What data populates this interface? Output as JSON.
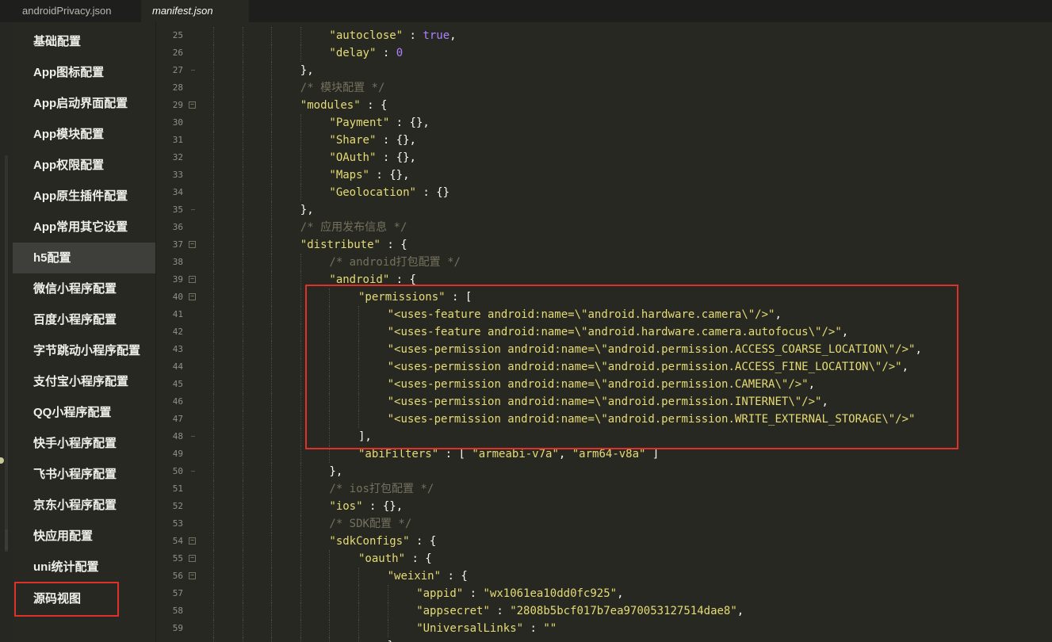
{
  "tabs": [
    {
      "label": "androidPrivacy.json",
      "active": false
    },
    {
      "label": "manifest.json",
      "active": true
    }
  ],
  "sidebar": {
    "items": [
      {
        "label": "基础配置"
      },
      {
        "label": "App图标配置"
      },
      {
        "label": "App启动界面配置"
      },
      {
        "label": "App模块配置"
      },
      {
        "label": "App权限配置"
      },
      {
        "label": "App原生插件配置"
      },
      {
        "label": "App常用其它设置"
      },
      {
        "label": "h5配置",
        "active": true
      },
      {
        "label": "微信小程序配置"
      },
      {
        "label": "百度小程序配置"
      },
      {
        "label": "字节跳动小程序配置"
      },
      {
        "label": "支付宝小程序配置"
      },
      {
        "label": "QQ小程序配置"
      },
      {
        "label": "快手小程序配置"
      },
      {
        "label": "飞书小程序配置"
      },
      {
        "label": "京东小程序配置"
      },
      {
        "label": "快应用配置"
      },
      {
        "label": "uni统计配置"
      },
      {
        "label": "源码视图",
        "highlighted": true
      }
    ]
  },
  "editor": {
    "lines": [
      {
        "n": "25",
        "indent": 4,
        "fold": "",
        "tokens": [
          [
            "k",
            "\"autoclose\""
          ],
          [
            "p",
            " : "
          ],
          [
            "b",
            "true"
          ],
          [
            "p",
            ","
          ]
        ]
      },
      {
        "n": "26",
        "indent": 4,
        "fold": "",
        "tokens": [
          [
            "k",
            "\"delay\""
          ],
          [
            "p",
            " : "
          ],
          [
            "b",
            "0"
          ]
        ]
      },
      {
        "n": "27",
        "indent": 3,
        "fold": "end",
        "tokens": [
          [
            "p",
            "},"
          ]
        ]
      },
      {
        "n": "28",
        "indent": 3,
        "fold": "",
        "tokens": [
          [
            "c",
            "/* 模块配置 */"
          ]
        ]
      },
      {
        "n": "29",
        "indent": 3,
        "fold": "open",
        "tokens": [
          [
            "k",
            "\"modules\""
          ],
          [
            "p",
            " : {"
          ]
        ]
      },
      {
        "n": "30",
        "indent": 4,
        "fold": "",
        "tokens": [
          [
            "k",
            "\"Payment\""
          ],
          [
            "p",
            " : {},"
          ]
        ]
      },
      {
        "n": "31",
        "indent": 4,
        "fold": "",
        "tokens": [
          [
            "k",
            "\"Share\""
          ],
          [
            "p",
            " : {},"
          ]
        ]
      },
      {
        "n": "32",
        "indent": 4,
        "fold": "",
        "tokens": [
          [
            "k",
            "\"OAuth\""
          ],
          [
            "p",
            " : {},"
          ]
        ]
      },
      {
        "n": "33",
        "indent": 4,
        "fold": "",
        "tokens": [
          [
            "k",
            "\"Maps\""
          ],
          [
            "p",
            " : {},"
          ]
        ]
      },
      {
        "n": "34",
        "indent": 4,
        "fold": "",
        "tokens": [
          [
            "k",
            "\"Geolocation\""
          ],
          [
            "p",
            " : {}"
          ]
        ]
      },
      {
        "n": "35",
        "indent": 3,
        "fold": "end",
        "tokens": [
          [
            "p",
            "},"
          ]
        ]
      },
      {
        "n": "36",
        "indent": 3,
        "fold": "",
        "tokens": [
          [
            "c",
            "/* 应用发布信息 */"
          ]
        ]
      },
      {
        "n": "37",
        "indent": 3,
        "fold": "open",
        "tokens": [
          [
            "k",
            "\"distribute\""
          ],
          [
            "p",
            " : {"
          ]
        ]
      },
      {
        "n": "38",
        "indent": 4,
        "fold": "",
        "tokens": [
          [
            "c",
            "/* android打包配置 */"
          ]
        ]
      },
      {
        "n": "39",
        "indent": 4,
        "fold": "open",
        "tokens": [
          [
            "k",
            "\"android\""
          ],
          [
            "p",
            " : {"
          ]
        ]
      },
      {
        "n": "40",
        "indent": 5,
        "fold": "open",
        "tokens": [
          [
            "k",
            "\"permissions\""
          ],
          [
            "p",
            " : ["
          ]
        ]
      },
      {
        "n": "41",
        "indent": 6,
        "fold": "",
        "tokens": [
          [
            "s",
            "\"<uses-feature android:name=\\\"android.hardware.camera\\\"/>\""
          ],
          [
            "p",
            ","
          ]
        ]
      },
      {
        "n": "42",
        "indent": 6,
        "fold": "",
        "tokens": [
          [
            "s",
            "\"<uses-feature android:name=\\\"android.hardware.camera.autofocus\\\"/>\""
          ],
          [
            "p",
            ","
          ]
        ]
      },
      {
        "n": "43",
        "indent": 6,
        "fold": "",
        "tokens": [
          [
            "s",
            "\"<uses-permission android:name=\\\"android.permission.ACCESS_COARSE_LOCATION\\\"/>\""
          ],
          [
            "p",
            ","
          ]
        ]
      },
      {
        "n": "44",
        "indent": 6,
        "fold": "",
        "tokens": [
          [
            "s",
            "\"<uses-permission android:name=\\\"android.permission.ACCESS_FINE_LOCATION\\\"/>\""
          ],
          [
            "p",
            ","
          ]
        ]
      },
      {
        "n": "45",
        "indent": 6,
        "fold": "",
        "tokens": [
          [
            "s",
            "\"<uses-permission android:name=\\\"android.permission.CAMERA\\\"/>\""
          ],
          [
            "p",
            ","
          ]
        ]
      },
      {
        "n": "46",
        "indent": 6,
        "fold": "",
        "tokens": [
          [
            "s",
            "\"<uses-permission android:name=\\\"android.permission.INTERNET\\\"/>\""
          ],
          [
            "p",
            ","
          ]
        ]
      },
      {
        "n": "47",
        "indent": 6,
        "fold": "",
        "tokens": [
          [
            "s",
            "\"<uses-permission android:name=\\\"android.permission.WRITE_EXTERNAL_STORAGE\\\"/>\""
          ]
        ]
      },
      {
        "n": "48",
        "indent": 5,
        "fold": "end",
        "tokens": [
          [
            "p",
            "],"
          ]
        ]
      },
      {
        "n": "49",
        "indent": 5,
        "fold": "",
        "tokens": [
          [
            "k",
            "\"abiFilters\""
          ],
          [
            "p",
            " : [ "
          ],
          [
            "s",
            "\"armeabi-v7a\""
          ],
          [
            "p",
            ", "
          ],
          [
            "s",
            "\"arm64-v8a\""
          ],
          [
            "p",
            " ]"
          ]
        ]
      },
      {
        "n": "50",
        "indent": 4,
        "fold": "end",
        "tokens": [
          [
            "p",
            "},"
          ]
        ]
      },
      {
        "n": "51",
        "indent": 4,
        "fold": "",
        "tokens": [
          [
            "c",
            "/* ios打包配置 */"
          ]
        ]
      },
      {
        "n": "52",
        "indent": 4,
        "fold": "",
        "tokens": [
          [
            "k",
            "\"ios\""
          ],
          [
            "p",
            " : {},"
          ]
        ]
      },
      {
        "n": "53",
        "indent": 4,
        "fold": "",
        "tokens": [
          [
            "c",
            "/* SDK配置 */"
          ]
        ]
      },
      {
        "n": "54",
        "indent": 4,
        "fold": "open",
        "tokens": [
          [
            "k",
            "\"sdkConfigs\""
          ],
          [
            "p",
            " : {"
          ]
        ]
      },
      {
        "n": "55",
        "indent": 5,
        "fold": "open",
        "tokens": [
          [
            "k",
            "\"oauth\""
          ],
          [
            "p",
            " : {"
          ]
        ]
      },
      {
        "n": "56",
        "indent": 6,
        "fold": "open",
        "tokens": [
          [
            "k",
            "\"weixin\""
          ],
          [
            "p",
            " : {"
          ]
        ]
      },
      {
        "n": "57",
        "indent": 7,
        "fold": "",
        "tokens": [
          [
            "k",
            "\"appid\""
          ],
          [
            "p",
            " : "
          ],
          [
            "s",
            "\"wx1061ea10dd0fc925\""
          ],
          [
            "p",
            ","
          ]
        ]
      },
      {
        "n": "58",
        "indent": 7,
        "fold": "",
        "tokens": [
          [
            "k",
            "\"appsecret\""
          ],
          [
            "p",
            " : "
          ],
          [
            "s",
            "\"2808b5bcf017b7ea970053127514dae8\""
          ],
          [
            "p",
            ","
          ]
        ]
      },
      {
        "n": "59",
        "indent": 7,
        "fold": "",
        "tokens": [
          [
            "k",
            "\"UniversalLinks\""
          ],
          [
            "p",
            " : "
          ],
          [
            "s",
            "\"\""
          ]
        ]
      },
      {
        "n": "60",
        "indent": 6,
        "fold": "end",
        "tokens": [
          [
            "p",
            "}"
          ]
        ]
      }
    ]
  }
}
